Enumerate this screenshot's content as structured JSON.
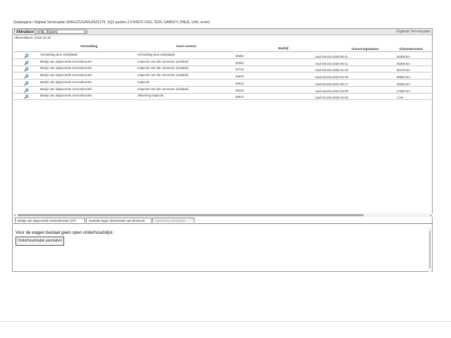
{
  "breadcrumb": "Startpagina / Digitaal Serviceplan (WAUZZZGA0LA021279, SQ2 quattro 2.0 R4221 DSG, 2020, GABSZY, DNUE, UA6, erwin)",
  "toolbar": {
    "print_label": "Afdrukken",
    "language_value": "nl-NL (Dutch)",
    "app_title": "Digitaal Serviceplan"
  },
  "delivery_date": "Afleverdatum: 2019-10-15",
  "table": {
    "headers": {
      "note": "Vermelding",
      "service_type": "Soort service",
      "company": "Bedrijf",
      "date": "Uitvoeringsdatum",
      "km": "Kilometerstand"
    },
    "rows": [
      {
        "note": "Vermelding door werkplaats",
        "service": "Vermelding door werkplaats",
        "company": "30364",
        "service_name": "Audi Service",
        "date": "2025-05-11",
        "km": "92300 km"
      },
      {
        "note": "Bewijs van uitgevoerde servicebeurten",
        "service": "Inspectie met olie verversen (variabel)",
        "company": "30364",
        "service_name": "Audi Service",
        "date": "2025-05-11",
        "km": "92300 km"
      },
      {
        "note": "Bewijs van uitgevoerde servicebeurten",
        "service": "Inspectie met olie verversen (variabel)",
        "company": "31712",
        "service_name": "Audi Service",
        "date": "2025-01-23",
        "km": "80176 km"
      },
      {
        "note": "Bewijs van uitgevoerde servicebeurten",
        "service": "Inspectie met olie verversen (variabel)",
        "company": "46879",
        "service_name": "Audi Service",
        "date": "2023-04-04",
        "km": "58660 km"
      },
      {
        "note": "Bewijs van uitgevoerde servicebeurten",
        "service": "Inspectie",
        "company": "46614",
        "service_name": "Audi Service",
        "date": "2021-09-17",
        "km": "39284 km"
      },
      {
        "note": "Bewijs van uitgevoerde servicebeurten",
        "service": "Inspectie met olie verversen (variabel)",
        "company": "38415",
        "service_name": "Audi Service",
        "date": "2021-03-09",
        "km": "27580 km"
      },
      {
        "note": "Bewijs van uitgevoerde servicebeurten",
        "service": "Aflevering inspectie",
        "company": "46614",
        "service_name": "Audi Service",
        "date": "2019-10-02",
        "km": "1 km"
      }
    ]
  },
  "tabs": [
    {
      "label": "Bewijs van uitgevoerde servicebeurten (07)"
    },
    {
      "label": "Garantie tegen doorroesten van binnenuit"
    },
    {
      "label": "Vermelding werkplaats"
    }
  ],
  "panel": {
    "message": "Voor de wagen bestaat geen open onderhoudslijst.",
    "button_label": "Onderhoudstabel aanmaken"
  }
}
